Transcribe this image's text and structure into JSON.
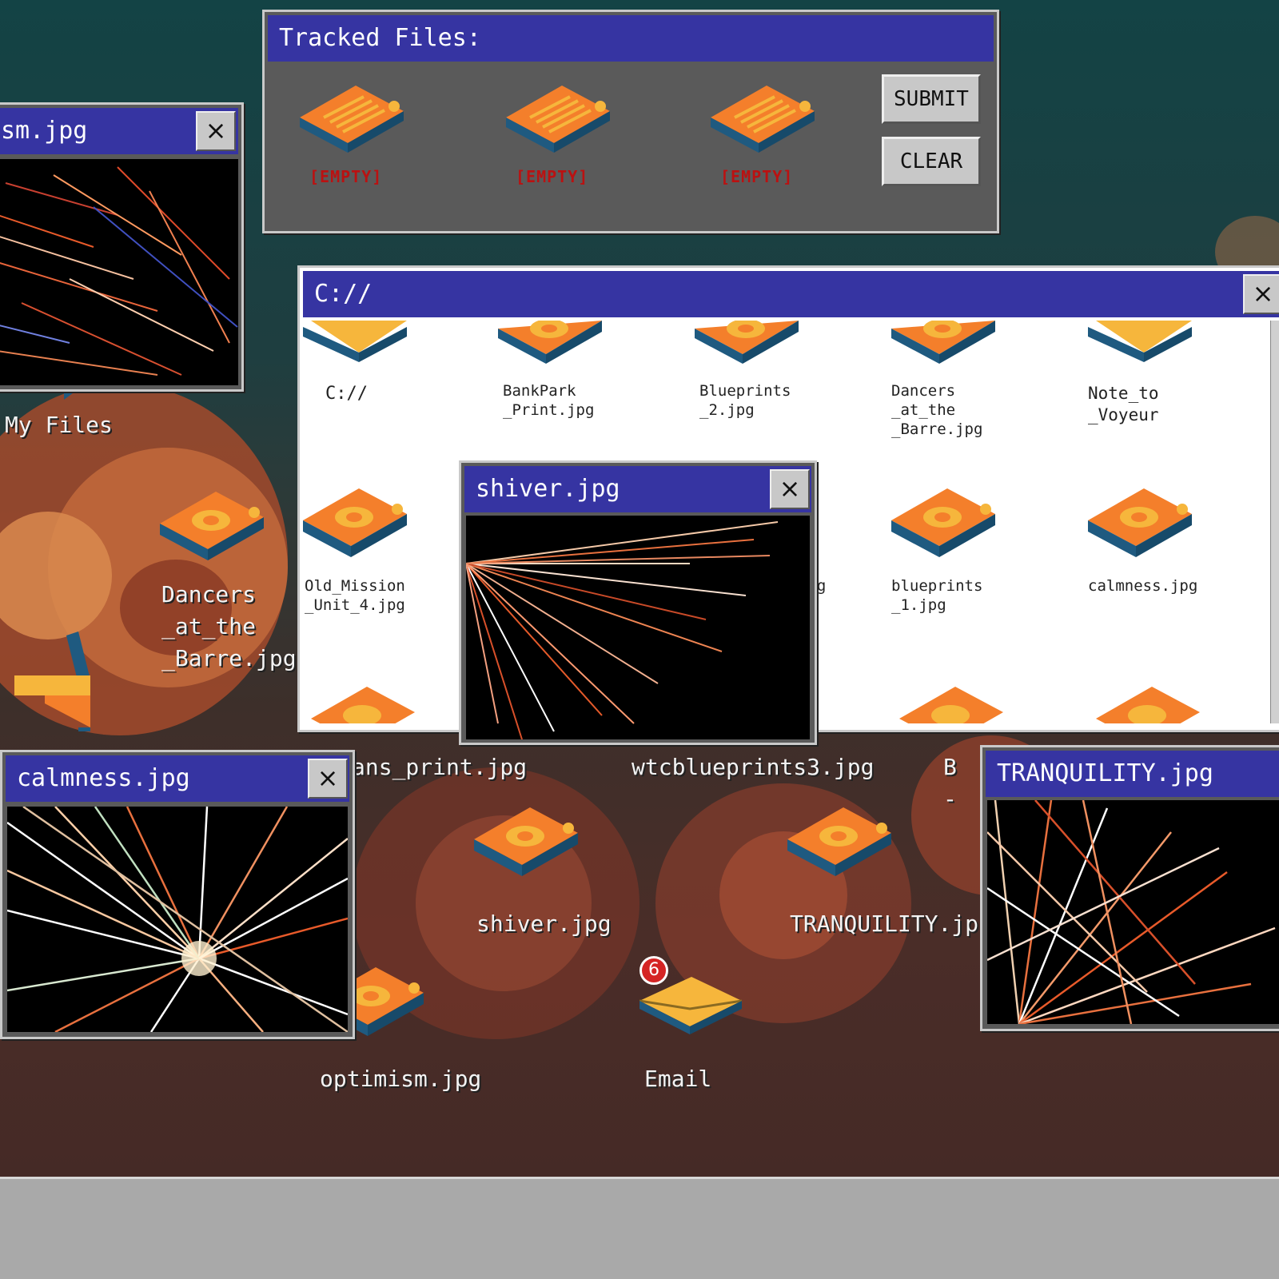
{
  "colors": {
    "titlebar": "#3634a2",
    "file_orange": "#f47f2b",
    "file_side": "#1f5a80",
    "folder_yellow": "#f6b63c"
  },
  "tracked": {
    "title": "Tracked Files:",
    "slots": [
      {
        "label": "[EMPTY]",
        "icon": "document-icon"
      },
      {
        "label": "[EMPTY]",
        "icon": "document-icon"
      },
      {
        "label": "[EMPTY]",
        "icon": "document-icon"
      }
    ],
    "submit_label": "SUBMIT",
    "clear_label": "CLEAR"
  },
  "optimism_window": {
    "title": "sm.jpg",
    "close": "×"
  },
  "explorer": {
    "title": "C://",
    "close": "×",
    "items": [
      {
        "label": "C://",
        "icon": "folder-icon"
      },
      {
        "label": "BankPark\n_Print.jpg",
        "icon": "image-file-icon"
      },
      {
        "label": "Blueprints\n_2.jpg",
        "icon": "image-file-icon"
      },
      {
        "label": "Dancers\n_at_the\n_Barre.jpg",
        "icon": "image-file-icon"
      },
      {
        "label": "Note_to\n_Voyeur",
        "icon": "folder-icon"
      },
      {
        "label": "Old_Mission\n_Unit_4.jpg",
        "icon": "image-file-icon"
      },
      {
        "label": "jpg",
        "icon": "image-file-icon"
      },
      {
        "label": "blueprints\n_1.jpg",
        "icon": "image-file-icon"
      },
      {
        "label": "calmness.jpg",
        "icon": "image-file-icon"
      }
    ]
  },
  "shiver_window": {
    "title": "shiver.jpg",
    "close": "×"
  },
  "calmness_window": {
    "title": "calmness.jpg",
    "close": "×"
  },
  "tranquility_window": {
    "title": "TRANQUILITY.jpg"
  },
  "desktop": {
    "my_files": "My Files",
    "dancers": "Dancers\n_at_the\n_Barre.jpg",
    "plans_print": "ans_print.jpg",
    "wtc": "wtcblueprints3.jpg",
    "b_partial": "B",
    "dash_partial": "-",
    "shiver": "shiver.jpg",
    "tranquility": "TRANQUILITY.jp",
    "optimism": "optimism.jpg",
    "email": "Email",
    "email_badge": "6"
  }
}
